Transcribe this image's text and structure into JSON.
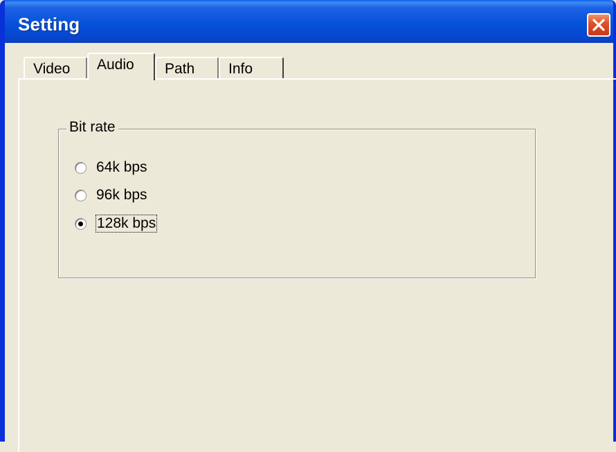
{
  "window": {
    "title": "Setting",
    "close_icon": "close-icon"
  },
  "tabs": [
    {
      "label": "Video",
      "selected": false
    },
    {
      "label": "Audio",
      "selected": true
    },
    {
      "label": "Path",
      "selected": false
    },
    {
      "label": "Info",
      "selected": false
    }
  ],
  "bitrate_group": {
    "legend": "Bit rate",
    "options": [
      {
        "label": "64k bps",
        "checked": false
      },
      {
        "label": "96k bps",
        "checked": false
      },
      {
        "label": "128k bps",
        "checked": true
      }
    ]
  },
  "colors": {
    "titlebar": "#0552da",
    "dialog_bg": "#ece9d8",
    "close_button": "#e0532b"
  }
}
